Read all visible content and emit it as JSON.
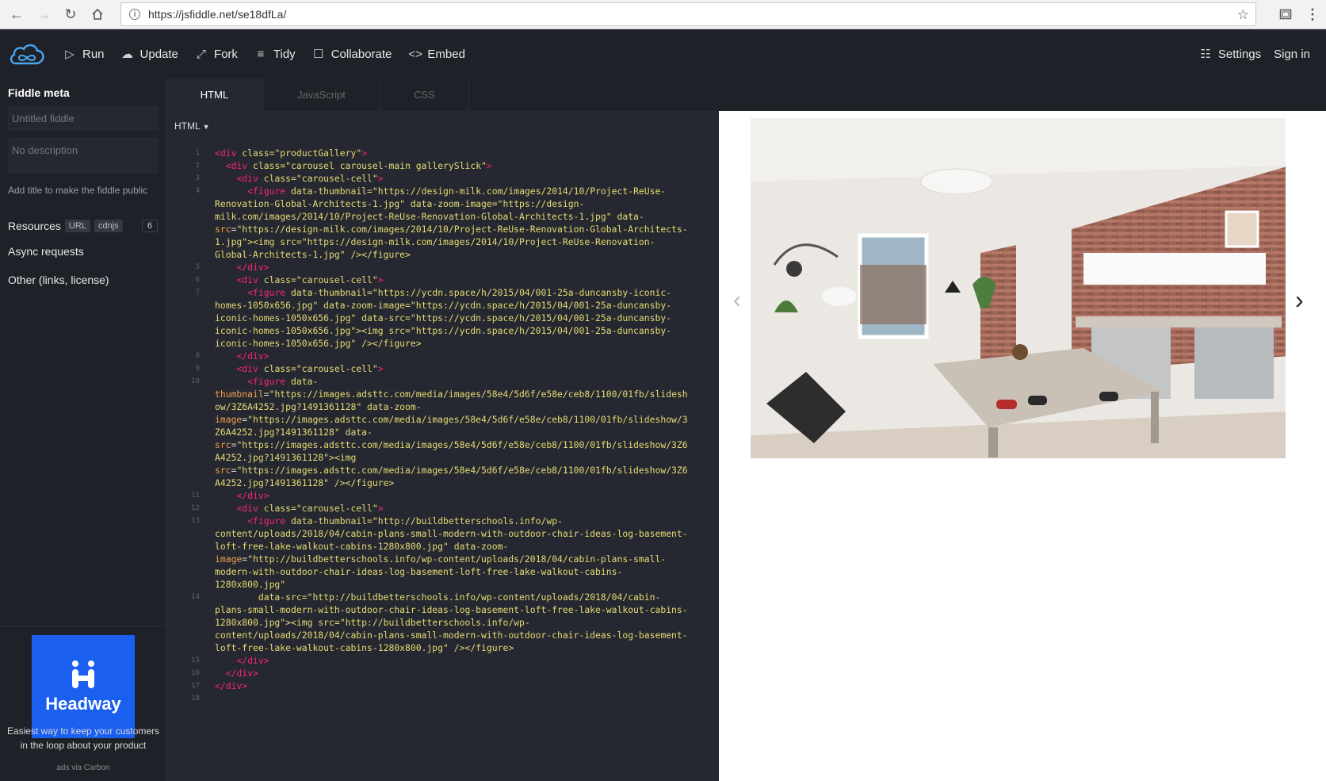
{
  "browser": {
    "url": "https://jsfiddle.net/se18dfLa/"
  },
  "toolbar": {
    "run": "Run",
    "update": "Update",
    "fork": "Fork",
    "tidy": "Tidy",
    "collaborate": "Collaborate",
    "embed": "Embed",
    "settings": "Settings",
    "sign_in": "Sign in"
  },
  "sidebar": {
    "heading": "Fiddle meta",
    "title_placeholder": "Untitled fiddle",
    "description_placeholder": "No description",
    "hint": "Add title to make the fiddle public",
    "resources_label": "Resources",
    "resources_tags": [
      "URL",
      "cdnjs"
    ],
    "resources_count": "6",
    "async": "Async requests",
    "other": "Other (links, license)"
  },
  "ad": {
    "brand": "Headway",
    "text": "Easiest way to keep your customers in the loop about your product",
    "footer": "ads via Carbon"
  },
  "tabs": [
    "HTML",
    "JavaScript",
    "CSS"
  ],
  "editor": {
    "language": "HTML",
    "lines": [
      {
        "n": "1",
        "text": "<div class=\"productGallery\">"
      },
      {
        "n": "2",
        "text": "  <div class=\"carousel carousel-main gallerySlick\">"
      },
      {
        "n": "3",
        "text": "    <div class=\"carousel-cell\">"
      },
      {
        "n": "4",
        "text": "      <figure data-thumbnail=\"https://design-milk.com/images/2014/10/Project-ReUse-"
      },
      {
        "n": "",
        "text": "Renovation-Global-Architects-1.jpg\" data-zoom-image=\"https://design-"
      },
      {
        "n": "",
        "text": "milk.com/images/2014/10/Project-ReUse-Renovation-Global-Architects-1.jpg\" data-"
      },
      {
        "n": "",
        "text": "src=\"https://design-milk.com/images/2014/10/Project-ReUse-Renovation-Global-Architects-"
      },
      {
        "n": "",
        "text": "1.jpg\"><img src=\"https://design-milk.com/images/2014/10/Project-ReUse-Renovation-"
      },
      {
        "n": "",
        "text": "Global-Architects-1.jpg\" /></figure>"
      },
      {
        "n": "5",
        "text": "    </div>"
      },
      {
        "n": "6",
        "text": "    <div class=\"carousel-cell\">"
      },
      {
        "n": "7",
        "text": "      <figure data-thumbnail=\"https://ycdn.space/h/2015/04/001-25a-duncansby-iconic-"
      },
      {
        "n": "",
        "text": "homes-1050x656.jpg\" data-zoom-image=\"https://ycdn.space/h/2015/04/001-25a-duncansby-"
      },
      {
        "n": "",
        "text": "iconic-homes-1050x656.jpg\" data-src=\"https://ycdn.space/h/2015/04/001-25a-duncansby-"
      },
      {
        "n": "",
        "text": "iconic-homes-1050x656.jpg\"><img src=\"https://ycdn.space/h/2015/04/001-25a-duncansby-"
      },
      {
        "n": "",
        "text": "iconic-homes-1050x656.jpg\" /></figure>"
      },
      {
        "n": "8",
        "text": "    </div>"
      },
      {
        "n": "9",
        "text": "    <div class=\"carousel-cell\">"
      },
      {
        "n": "10",
        "text": "      <figure data-"
      },
      {
        "n": "",
        "text": "thumbnail=\"https://images.adsttc.com/media/images/58e4/5d6f/e58e/ceb8/1100/01fb/slidesh"
      },
      {
        "n": "",
        "text": "ow/3Z6A4252.jpg?1491361128\" data-zoom-"
      },
      {
        "n": "",
        "text": "image=\"https://images.adsttc.com/media/images/58e4/5d6f/e58e/ceb8/1100/01fb/slideshow/3"
      },
      {
        "n": "",
        "text": "Z6A4252.jpg?1491361128\" data-"
      },
      {
        "n": "",
        "text": "src=\"https://images.adsttc.com/media/images/58e4/5d6f/e58e/ceb8/1100/01fb/slideshow/3Z6"
      },
      {
        "n": "",
        "text": "A4252.jpg?1491361128\"><img"
      },
      {
        "n": "",
        "text": "src=\"https://images.adsttc.com/media/images/58e4/5d6f/e58e/ceb8/1100/01fb/slideshow/3Z6"
      },
      {
        "n": "",
        "text": "A4252.jpg?1491361128\" /></figure>"
      },
      {
        "n": "11",
        "text": "    </div>"
      },
      {
        "n": "12",
        "text": "    <div class=\"carousel-cell\">"
      },
      {
        "n": "13",
        "text": "      <figure data-thumbnail=\"http://buildbetterschools.info/wp-"
      },
      {
        "n": "",
        "text": "content/uploads/2018/04/cabin-plans-small-modern-with-outdoor-chair-ideas-log-basement-"
      },
      {
        "n": "",
        "text": "loft-free-lake-walkout-cabins-1280x800.jpg\" data-zoom-"
      },
      {
        "n": "",
        "text": "image=\"http://buildbetterschools.info/wp-content/uploads/2018/04/cabin-plans-small-"
      },
      {
        "n": "",
        "text": "modern-with-outdoor-chair-ideas-log-basement-loft-free-lake-walkout-cabins-"
      },
      {
        "n": "",
        "text": "1280x800.jpg\""
      },
      {
        "n": "14",
        "text": "        data-src=\"http://buildbetterschools.info/wp-content/uploads/2018/04/cabin-"
      },
      {
        "n": "",
        "text": "plans-small-modern-with-outdoor-chair-ideas-log-basement-loft-free-lake-walkout-cabins-"
      },
      {
        "n": "",
        "text": "1280x800.jpg\"><img src=\"http://buildbetterschools.info/wp-"
      },
      {
        "n": "",
        "text": "content/uploads/2018/04/cabin-plans-small-modern-with-outdoor-chair-ideas-log-basement-"
      },
      {
        "n": "",
        "text": "loft-free-lake-walkout-cabins-1280x800.jpg\" /></figure>"
      },
      {
        "n": "15",
        "text": "    </div>"
      },
      {
        "n": "16",
        "text": "  </div>"
      },
      {
        "n": "17",
        "text": "</div>"
      },
      {
        "n": "18",
        "text": ""
      }
    ]
  },
  "result": {
    "prev_icon": "chevron-left-icon",
    "next_icon": "chevron-right-icon"
  }
}
